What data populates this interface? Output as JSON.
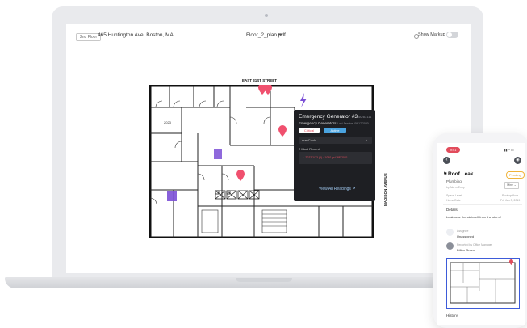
{
  "header": {
    "floor_badge": "2nd Floor",
    "address": "465 Huntington Ave, Boston, MA",
    "filename": "Floor_2_plan.pdf",
    "more": "•••",
    "markup_label": "Show Markup"
  },
  "plan": {
    "street_top": "EAST 31ST STREET",
    "street_side": "MADISON AVENUE",
    "room_labels": [
      "2023"
    ]
  },
  "tooltip": {
    "title": "Emergency Generator #3",
    "id": "RA283111",
    "subtitle": "Emergency Generators",
    "last_service": "Last Service: 09/17/2020",
    "critical": "Critical",
    "active": "Active",
    "select_value": "manCook",
    "caret": "⌄",
    "recent_label": "2 Most Recent",
    "reading": "▲ 2022/1/23 (6) · 1050 psi WF 2021",
    "view_all": "View All Readings ↗"
  },
  "phone": {
    "status_time": "9:41",
    "status_icons": "▮▮ ◔ ▭",
    "back": "‹",
    "camera": "◉",
    "title": "Roof Leak",
    "pending": "Pending",
    "category": "Plumbing",
    "sub": "by Alarm Entry",
    "mine": "Mine ⌄",
    "meta_l1": "Space Level",
    "meta_r1": "Rooftop floor",
    "meta_l2": "Home Date",
    "meta_r2": "Fri, Jan 3, 2019",
    "details_heading": "Details",
    "details_text": "Leak near the stairwell from the storm!",
    "assignee_label": "Assignee",
    "assignee": "Unassigned",
    "reporter_label": "Reported by Office Manager",
    "reporter": "Dillon Green",
    "history": "History"
  },
  "colors": {
    "accent_red": "#e24c5c",
    "accent_blue": "#4aa3df",
    "purple_icon": "#7b4fd6",
    "tooltip_bg": "#1e1f23"
  }
}
